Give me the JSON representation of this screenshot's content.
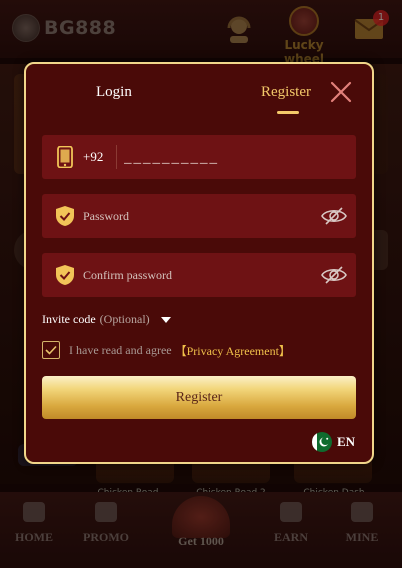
{
  "header": {
    "logo_text": "BG888",
    "lucky_wheel_label": "Lucky wheel",
    "mail_badge": "1"
  },
  "games": [
    "Chicken Road",
    "Chicken Road 2",
    "Chicken Dash"
  ],
  "bottom_nav": {
    "home": "HOME",
    "promo": "PROMO",
    "center": "Get 1000",
    "earn": "EARN",
    "mine": "MINE"
  },
  "modal": {
    "tabs": {
      "login": "Login",
      "register": "Register"
    },
    "active_tab": "Register",
    "phone": {
      "prefix": "+92",
      "placeholder": "__________"
    },
    "password": {
      "placeholder": "Password"
    },
    "confirm_password": {
      "placeholder": "Confirm password"
    },
    "invite": {
      "label": "Invite code",
      "optional": "(Optional)"
    },
    "agreement": {
      "text": "I have read and agree",
      "link": "【Privacy Agreement】",
      "checked": true
    },
    "submit_label": "Register",
    "language": "EN"
  },
  "colors": {
    "accent_gold": "#f4c96a",
    "modal_bg": "#4a0a08",
    "field_bg": "#6e1214"
  }
}
